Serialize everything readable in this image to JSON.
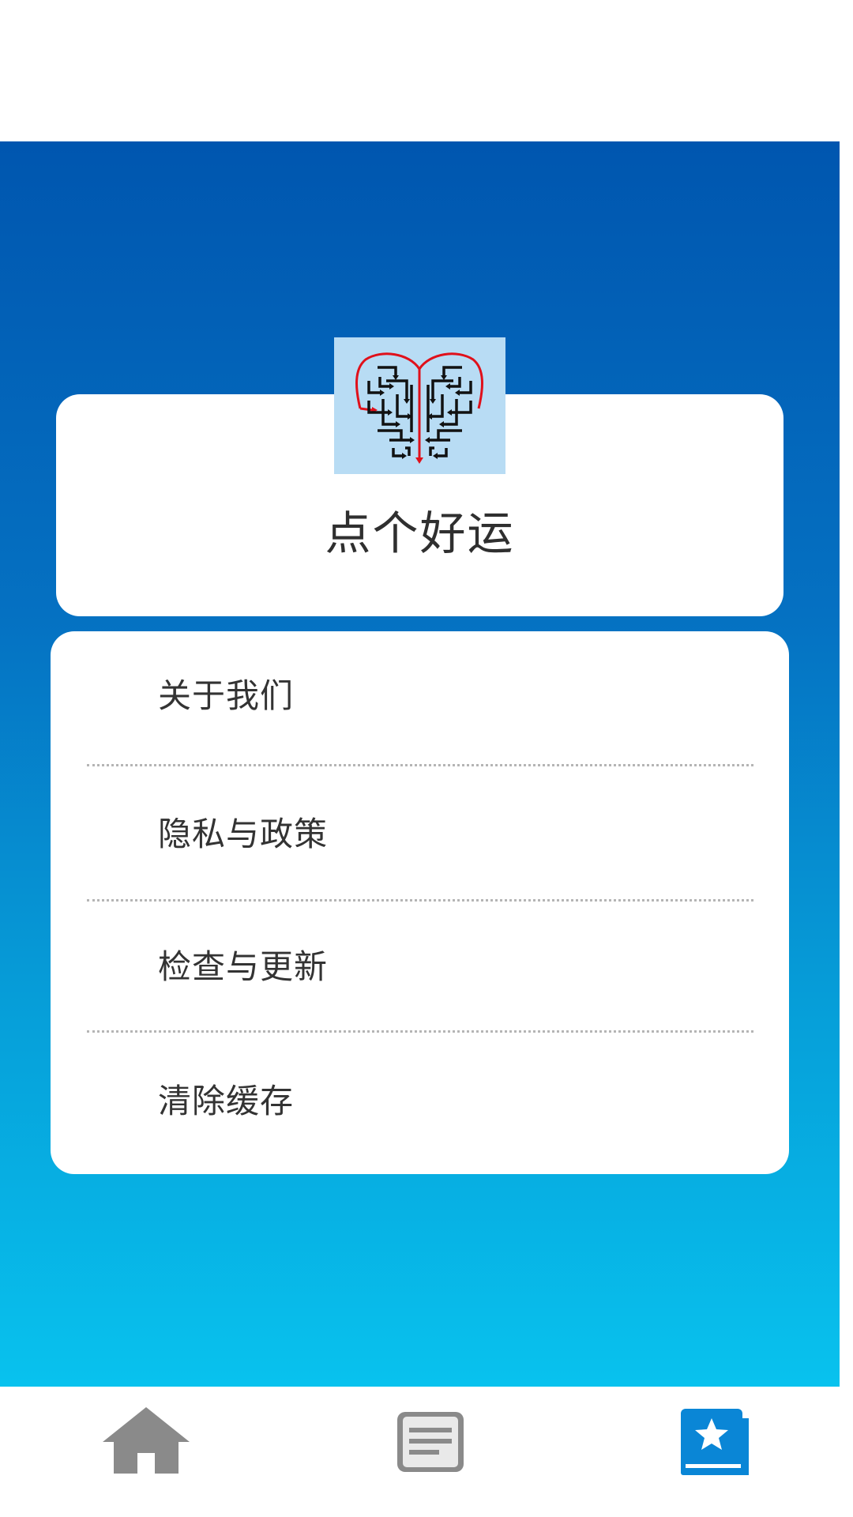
{
  "app": {
    "name": "点个好运"
  },
  "menu": {
    "items": [
      {
        "label": "关于我们"
      },
      {
        "label": "隐私与政策"
      },
      {
        "label": "检查与更新"
      },
      {
        "label": "清除缓存"
      }
    ]
  },
  "tabs": [
    {
      "icon": "home-icon",
      "active": false
    },
    {
      "icon": "list-icon",
      "active": false
    },
    {
      "icon": "bookmark-star-icon",
      "active": true
    }
  ],
  "colors": {
    "gradient_top": "#0056af",
    "gradient_bottom": "#08c2ee",
    "tab_inactive": "#8a8a8a",
    "tab_active": "#0a86d6",
    "logo_bg": "#b8dcf4",
    "logo_red": "#e0101a"
  }
}
